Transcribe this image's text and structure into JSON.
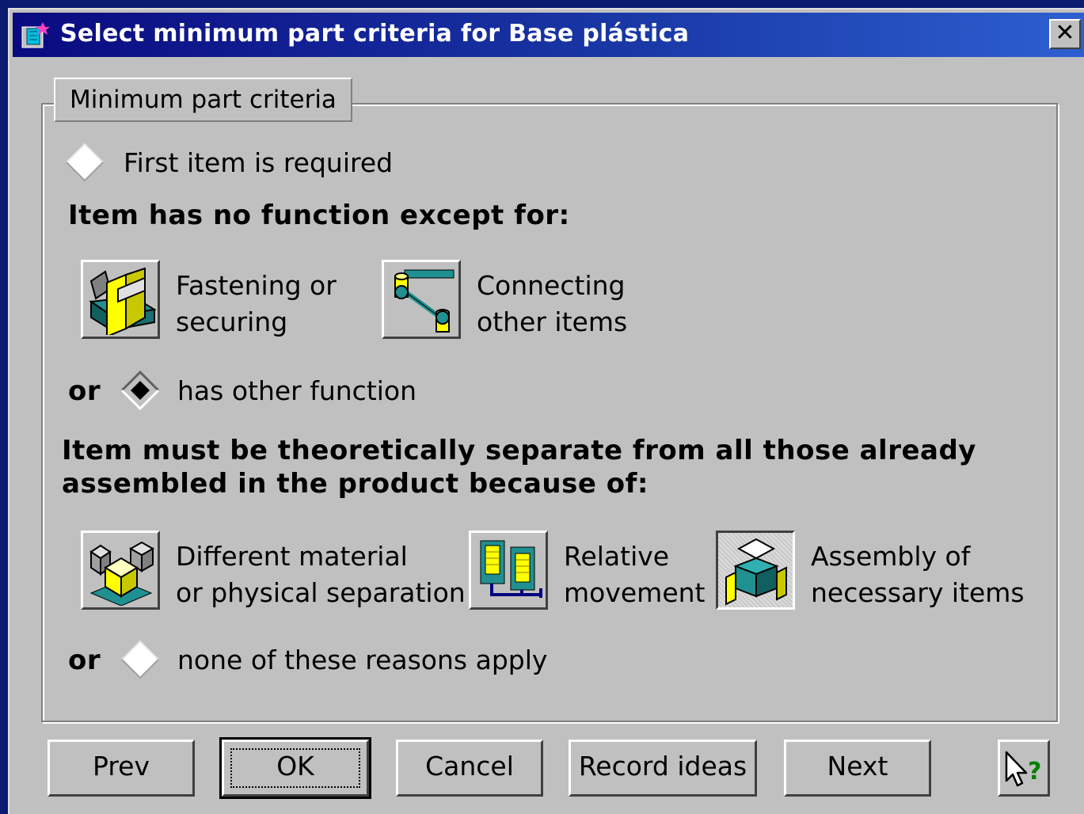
{
  "window": {
    "title": "Select minimum part criteria for Base plástica",
    "close_label": "✕"
  },
  "group": {
    "label": "Minimum part criteria"
  },
  "first_item": {
    "label": "First item is required",
    "checked": false
  },
  "function_section": {
    "heading": "Item has no function except for:",
    "options": [
      {
        "label": "Fastening or\nsecuring",
        "icon": "fastening-icon"
      },
      {
        "label": "Connecting\nother items",
        "icon": "connecting-icon"
      }
    ],
    "or_label": "or",
    "other": {
      "label": "has other function",
      "checked": true
    }
  },
  "separation_section": {
    "heading": "Item must be theoretically separate from all those already\nassembled in the product because of:",
    "options": [
      {
        "label": "Different material\nor physical separation",
        "icon": "different-material-icon"
      },
      {
        "label": "Relative\nmovement",
        "icon": "relative-movement-icon"
      },
      {
        "label": "Assembly of\nnecessary items",
        "icon": "assembly-icon"
      }
    ],
    "or_label": "or",
    "none": {
      "label": "none of these reasons apply",
      "checked": false
    }
  },
  "buttons": {
    "prev": "Prev",
    "ok": "OK",
    "cancel": "Cancel",
    "record": "Record ideas",
    "next": "Next",
    "help": "help-pointer-icon"
  },
  "colors": {
    "title_bar_start": "#0a0a80",
    "title_bar_end": "#2d5fd0",
    "face": "#c0c0c0",
    "teal": "#20a0a0",
    "yellow": "#ffff00"
  }
}
